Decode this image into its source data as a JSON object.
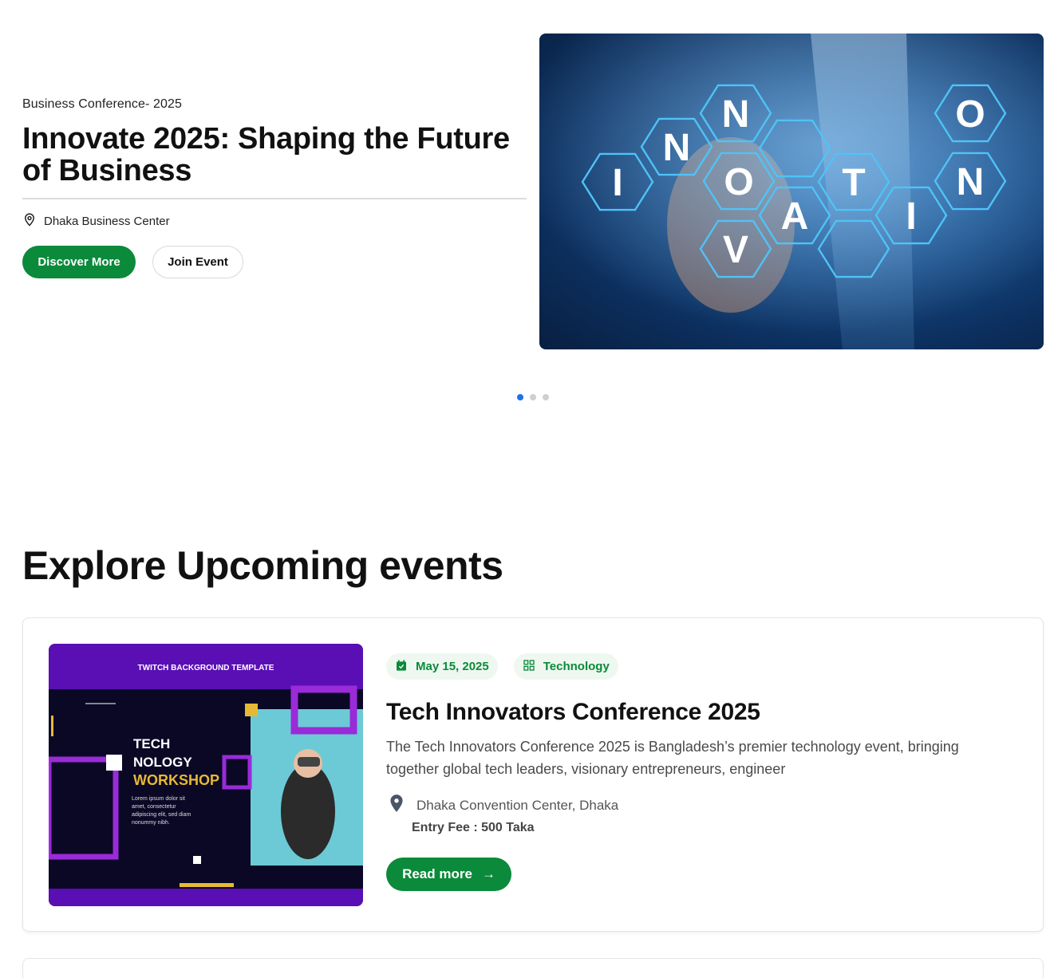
{
  "hero": {
    "eyebrow": "Business Conference-  2025",
    "title": "Innovate 2025: Shaping the Future of Business",
    "location": "Dhaka Business Center",
    "discover_label": "Discover More",
    "join_label": "Join Event",
    "image_letters": [
      "I",
      "N",
      "N",
      "O",
      "V",
      "A",
      "T",
      "I",
      "O",
      "N"
    ]
  },
  "carousel": {
    "total": 3,
    "active": 1
  },
  "section": {
    "title": "Explore Upcoming events"
  },
  "event": {
    "date": "May 15, 2025",
    "category": "Technology",
    "title": "Tech Innovators Conference 2025",
    "description": "The Tech Innovators Conference 2025 is Bangladesh’s premier technology event, bringing together global tech leaders, visionary entrepreneurs, engineer",
    "location": "Dhaka Convention Center, Dhaka",
    "fee": "Entry Fee : 500 Taka",
    "read_more_label": "Read more",
    "arrow": "→",
    "image": {
      "banner": "TWITCH BACKGROUND TEMPLATE",
      "line1": "TECH",
      "line2": "NOLOGY",
      "line3": "WORKSHOP",
      "body": "Lorem ipsum dolor sit amet, consectetur adipiscing elit, sed diam nonummy nibh."
    }
  },
  "colors": {
    "accent": "#0a8a3a",
    "dot_active": "#1a73e8",
    "tag_bg": "#eef8f0"
  }
}
